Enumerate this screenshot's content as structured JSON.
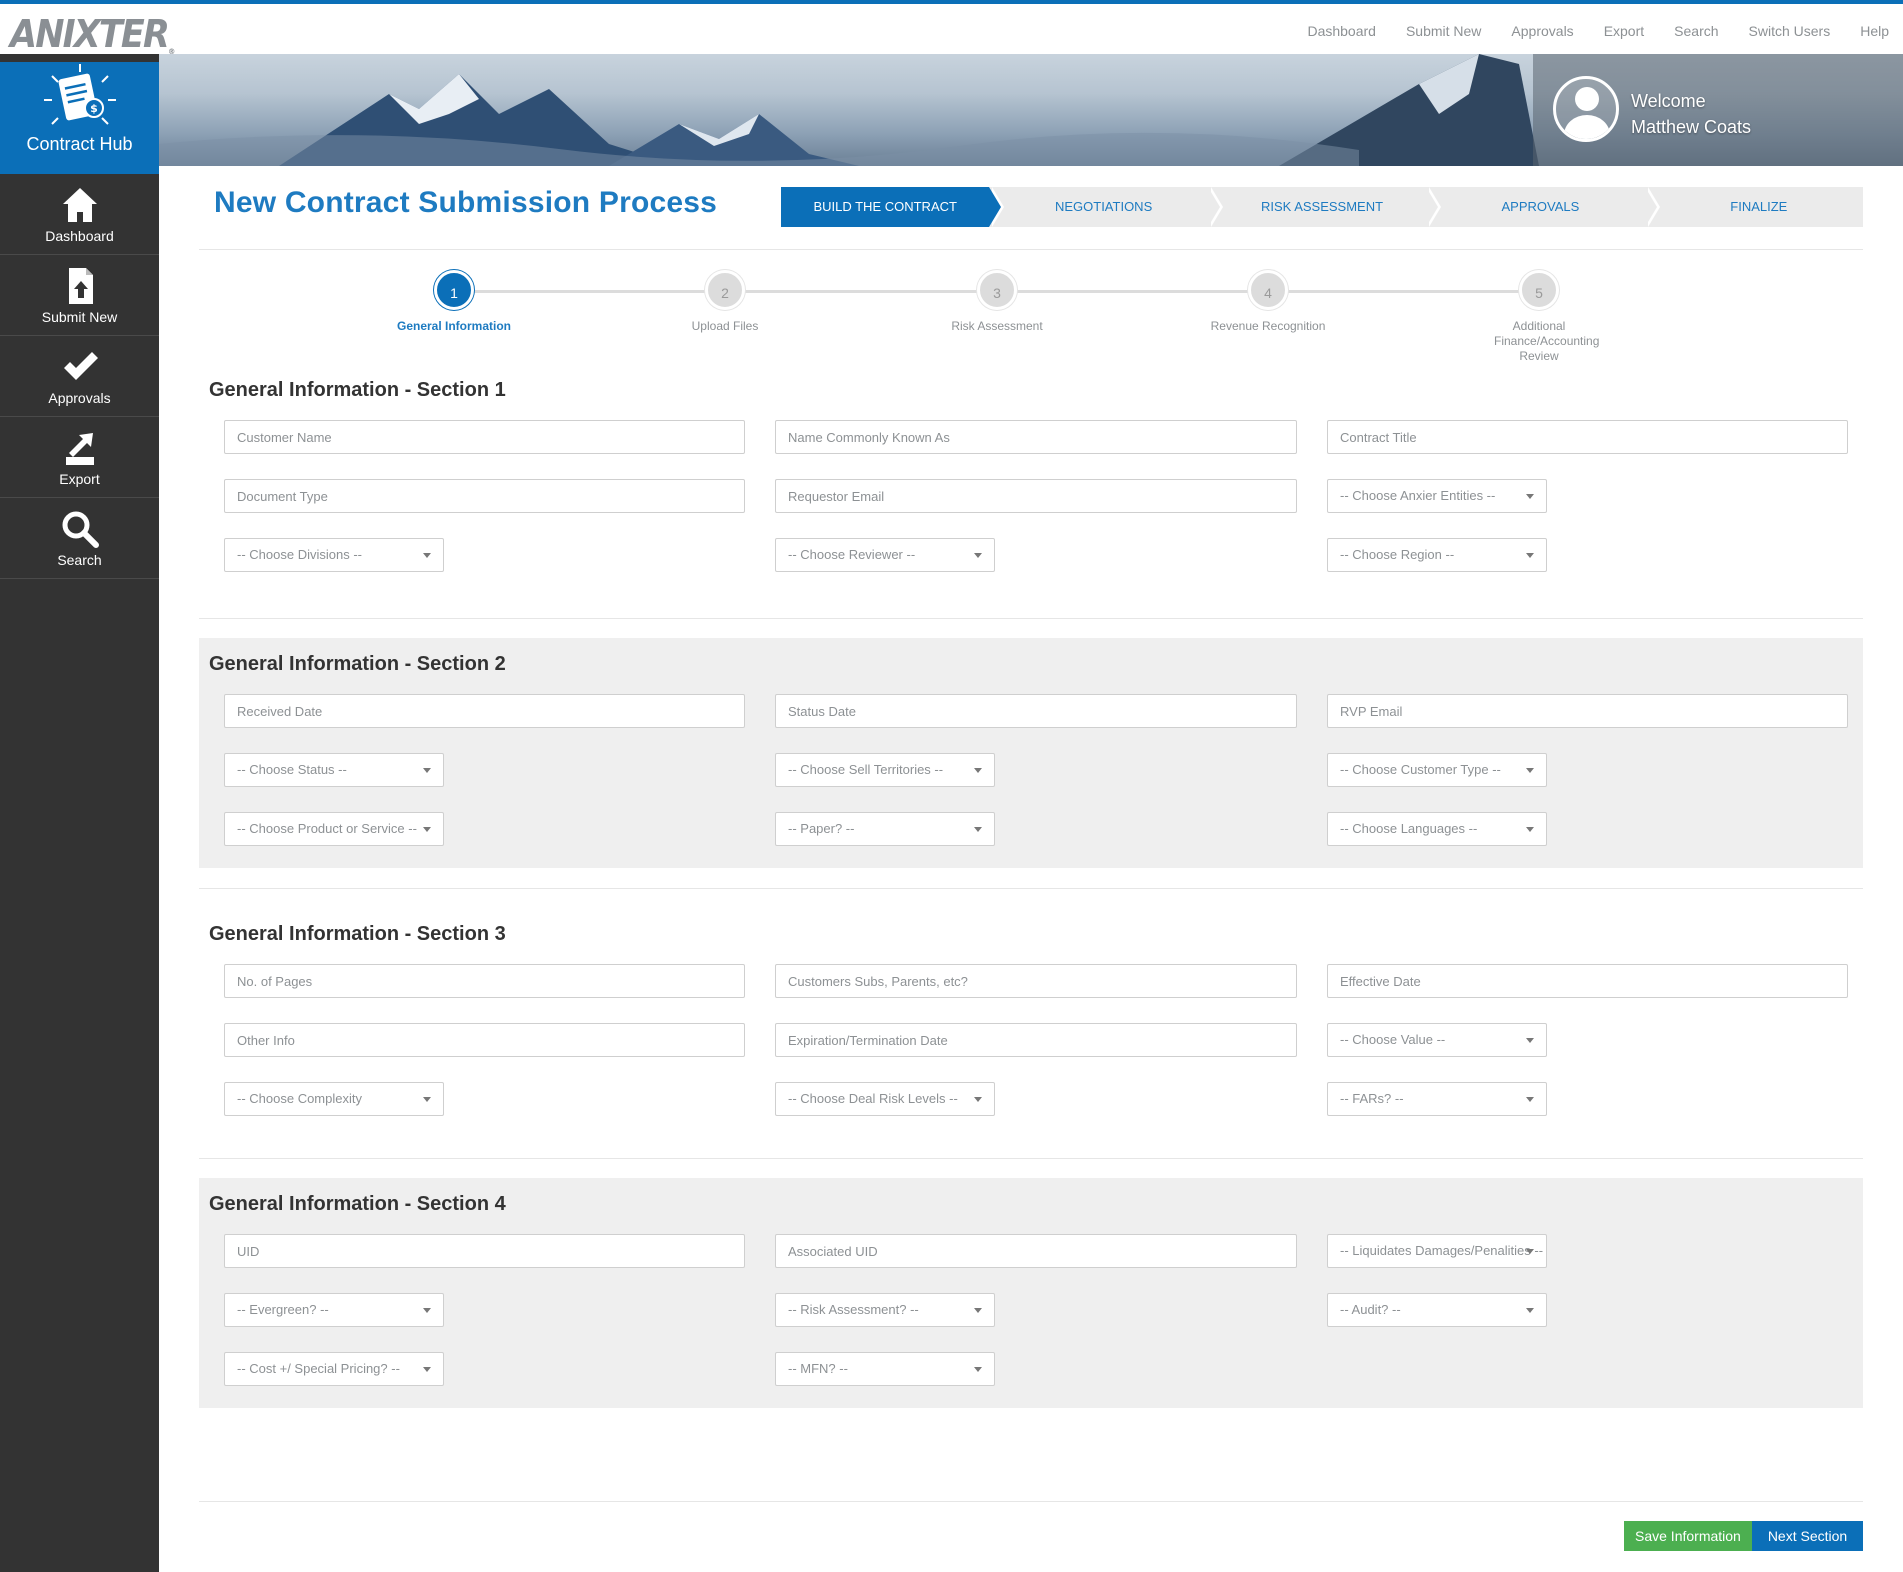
{
  "brand": {
    "logo_text": "ANIXTER",
    "app_name": "Contract Hub"
  },
  "top_nav": [
    "Dashboard",
    "Submit New",
    "Approvals",
    "Export",
    "Search",
    "Switch Users",
    "Help"
  ],
  "user": {
    "welcome": "Welcome",
    "name": "Matthew Coats"
  },
  "sidebar": {
    "items": [
      {
        "label": "Dashboard",
        "icon": "home-icon"
      },
      {
        "label": "Submit New",
        "icon": "upload-document-icon"
      },
      {
        "label": "Approvals",
        "icon": "checkmark-icon"
      },
      {
        "label": "Export",
        "icon": "export-icon"
      },
      {
        "label": "Search",
        "icon": "search-icon"
      }
    ]
  },
  "page_title": "New Contract Submission Process",
  "wizard": {
    "active_index": 0,
    "stages": [
      "BUILD THE CONTRACT",
      "NEGOTIATIONS",
      "RISK ASSESSMENT",
      "APPROVALS",
      "FINALIZE"
    ]
  },
  "steps": {
    "active_index": 0,
    "items": [
      {
        "num": "1",
        "label": "General Information"
      },
      {
        "num": "2",
        "label": "Upload Files"
      },
      {
        "num": "3",
        "label": "Risk Assessment"
      },
      {
        "num": "4",
        "label": "Revenue Recognition"
      },
      {
        "num": "5",
        "label": "Additional Finance/Accounting Review"
      }
    ]
  },
  "sections": [
    {
      "title": "General Information - Section 1",
      "rows": [
        [
          {
            "type": "input",
            "placeholder": "Customer Name"
          },
          {
            "type": "input",
            "placeholder": "Name Commonly Known As"
          },
          {
            "type": "input",
            "placeholder": "Contract Title"
          }
        ],
        [
          {
            "type": "input",
            "placeholder": "Document Type"
          },
          {
            "type": "input",
            "placeholder": "Requestor Email"
          },
          {
            "type": "select",
            "value": "-- Choose Anxier Entities --"
          }
        ],
        [
          {
            "type": "select",
            "value": "-- Choose Divisions --"
          },
          {
            "type": "select",
            "value": "-- Choose Reviewer --"
          },
          {
            "type": "select",
            "value": "-- Choose Region --"
          }
        ]
      ]
    },
    {
      "title": "General Information - Section 2",
      "rows": [
        [
          {
            "type": "input",
            "placeholder": "Received Date"
          },
          {
            "type": "input",
            "placeholder": "Status Date"
          },
          {
            "type": "input",
            "placeholder": "RVP Email"
          }
        ],
        [
          {
            "type": "select",
            "value": "-- Choose Status --"
          },
          {
            "type": "select",
            "value": "-- Choose Sell Territories --"
          },
          {
            "type": "select",
            "value": "-- Choose Customer Type --"
          }
        ],
        [
          {
            "type": "select",
            "value": "-- Choose Product or Service --"
          },
          {
            "type": "select",
            "value": "-- Paper? --"
          },
          {
            "type": "select",
            "value": "-- Choose Languages --"
          }
        ]
      ]
    },
    {
      "title": "General Information - Section 3",
      "rows": [
        [
          {
            "type": "input",
            "placeholder": "No. of Pages"
          },
          {
            "type": "input",
            "placeholder": "Customers Subs, Parents, etc?"
          },
          {
            "type": "input",
            "placeholder": "Effective Date"
          }
        ],
        [
          {
            "type": "input",
            "placeholder": "Other Info"
          },
          {
            "type": "input",
            "placeholder": "Expiration/Termination Date"
          },
          {
            "type": "select",
            "value": "-- Choose Value --"
          }
        ],
        [
          {
            "type": "select",
            "value": "-- Choose Complexity"
          },
          {
            "type": "select",
            "value": "-- Choose Deal Risk Levels --"
          },
          {
            "type": "select",
            "value": "-- FARs? --"
          }
        ]
      ]
    },
    {
      "title": "General Information - Section 4",
      "rows": [
        [
          {
            "type": "input",
            "placeholder": "UID"
          },
          {
            "type": "input",
            "placeholder": "Associated UID"
          },
          {
            "type": "select",
            "value": "-- Liquidates Damages/Penalities --"
          }
        ],
        [
          {
            "type": "select",
            "value": "-- Evergreen? --"
          },
          {
            "type": "select",
            "value": "-- Risk Assessment? --"
          },
          {
            "type": "select",
            "value": "-- Audit? --"
          }
        ],
        [
          {
            "type": "select",
            "value": "-- Cost +/ Special Pricing? --"
          },
          {
            "type": "select",
            "value": "-- MFN? --"
          }
        ]
      ]
    }
  ],
  "buttons": {
    "save": "Save Information",
    "next": "Next Section"
  },
  "colors": {
    "primary": "#0b6fb8",
    "sidebar": "#333333",
    "success": "#4caf50",
    "section_grey": "#efefef"
  }
}
